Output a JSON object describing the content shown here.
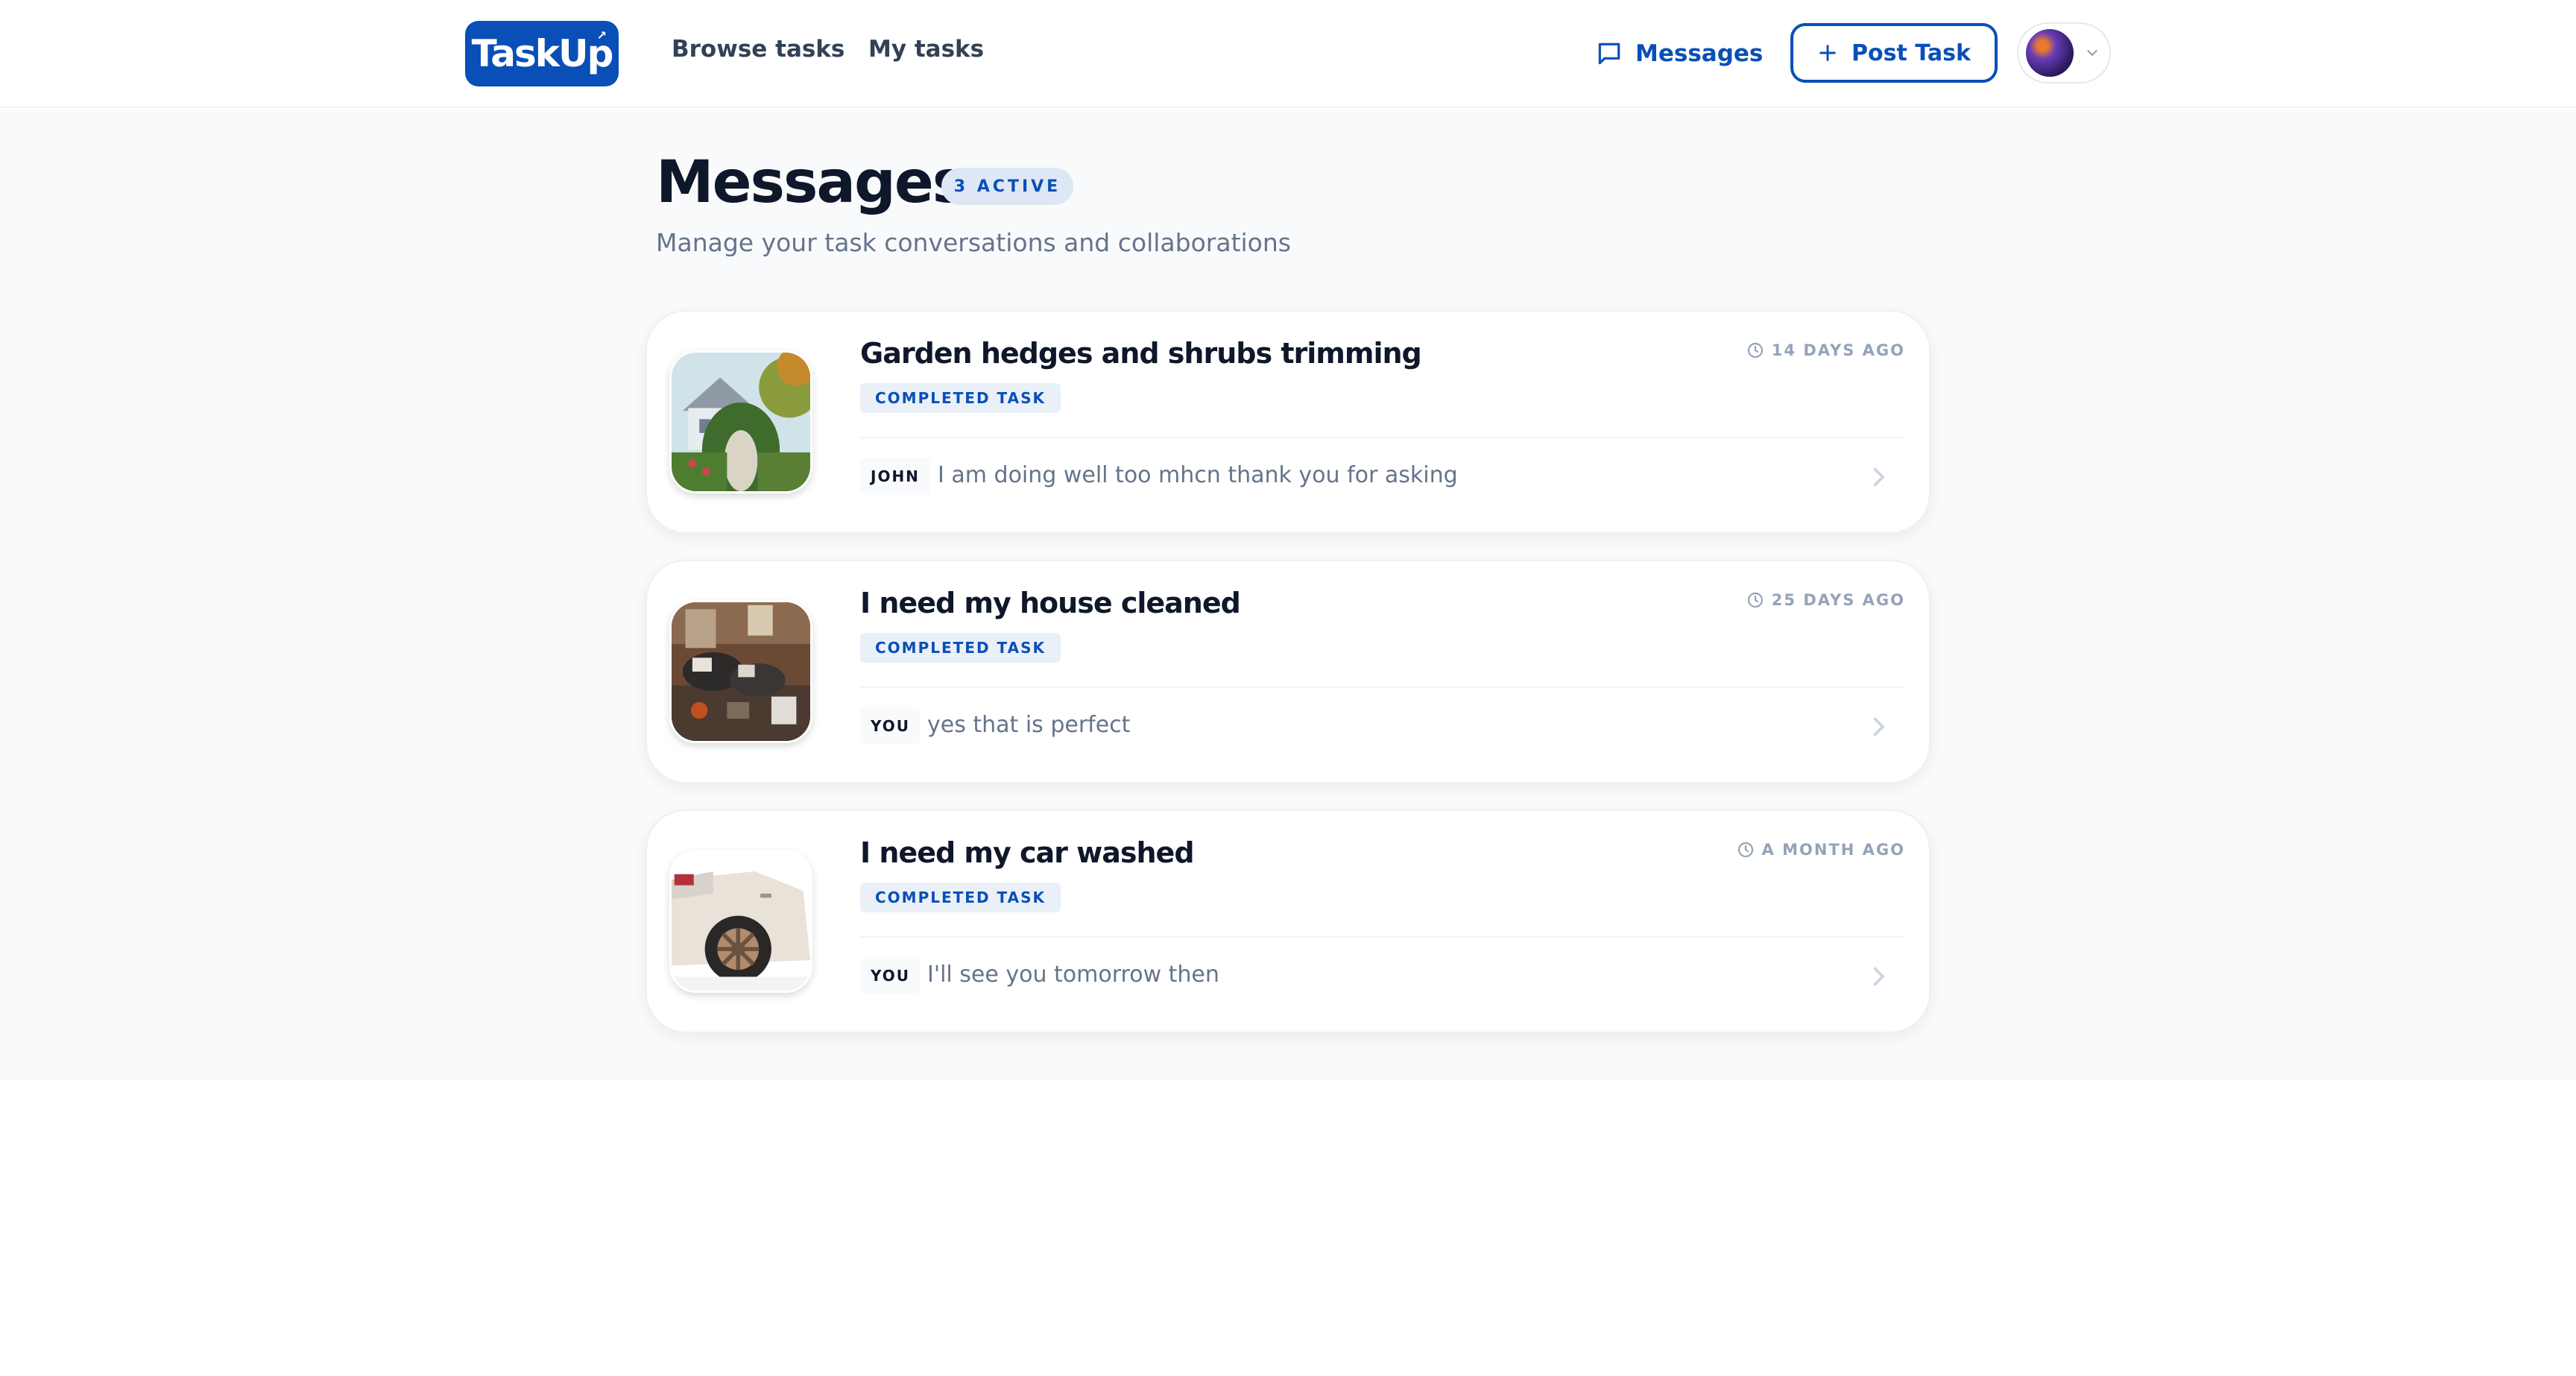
{
  "header": {
    "logo": "TaskUp",
    "nav": {
      "browse": "Browse tasks",
      "my_tasks": "My tasks"
    },
    "messages_label": "Messages",
    "post_task_label": "Post Task",
    "icons": [
      "chat-bubble-icon",
      "plus-icon",
      "chevron-down-icon"
    ]
  },
  "page": {
    "title": "Messages",
    "active_badge": "3 ACTIVE",
    "subtitle": "Manage your task conversations and collaborations"
  },
  "conversations": [
    {
      "title": "Garden hedges and shrubs trimming",
      "status": "COMPLETED TASK",
      "time": "14 DAYS AGO",
      "sender": "JOHN",
      "message": "I am doing well too mhcn thank you for asking"
    },
    {
      "title": "I need my house cleaned",
      "status": "COMPLETED TASK",
      "time": "25 DAYS AGO",
      "sender": "YOU",
      "message": "yes that is perfect"
    },
    {
      "title": "I need my car washed",
      "status": "COMPLETED TASK",
      "time": "A MONTH AGO",
      "sender": "YOU",
      "message": "I'll see you tomorrow then"
    }
  ],
  "colors": {
    "brand": "#0a4fb8",
    "muted_text": "#64748b",
    "background": "#f9fafb"
  }
}
